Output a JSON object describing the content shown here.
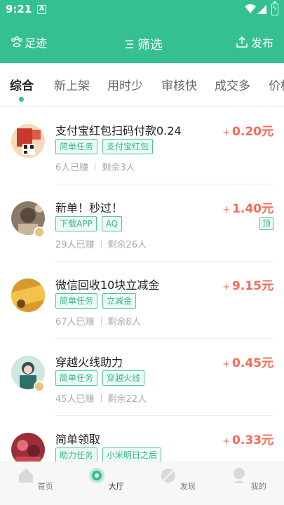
{
  "status": {
    "time": "9:21",
    "sim_label": "A"
  },
  "header": {
    "left_label": "足迹",
    "center_label": "筛选",
    "right_label": "发布"
  },
  "tabs": [
    "综合",
    "新上架",
    "用时少",
    "审核快",
    "成交多",
    "价格"
  ],
  "tasks": [
    {
      "title": "支付宝红包扫码付款0.24",
      "tags": [
        "简单任务",
        "支付宝红包"
      ],
      "earned": "6人已赚",
      "remaining": "剩余3人",
      "plus": "+",
      "price": "0.20元",
      "top_badge": ""
    },
    {
      "title": "新单！秒过！",
      "tags": [
        "下载APP",
        "AQ"
      ],
      "earned": "29人已赚",
      "remaining": "剩余26人",
      "plus": "+",
      "price": "1.40元",
      "top_badge": "顶"
    },
    {
      "title": "微信回收10块立减金",
      "tags": [
        "简单任务",
        "立减金"
      ],
      "earned": "67人已赚",
      "remaining": "剩余8人",
      "plus": "+",
      "price": "9.15元",
      "top_badge": ""
    },
    {
      "title": "穿越火线助力",
      "tags": [
        "简单任务",
        "穿越火线"
      ],
      "earned": "45人已赚",
      "remaining": "剩余22人",
      "plus": "+",
      "price": "0.45元",
      "top_badge": ""
    },
    {
      "title": "简单领取",
      "tags": [
        "助力任务",
        "小米明日之后"
      ],
      "earned": "",
      "remaining": "",
      "plus": "+",
      "price": "0.33元",
      "top_badge": ""
    }
  ],
  "bottom_nav": [
    {
      "label": "首页",
      "icon": "home-icon"
    },
    {
      "label": "大厅",
      "icon": "hall-icon"
    },
    {
      "label": "发现",
      "icon": "discover-icon"
    },
    {
      "label": "我的",
      "icon": "profile-icon"
    }
  ],
  "colors": {
    "brand": "#35c08f",
    "price": "#f56a57",
    "tag_border": "#4cc79b"
  }
}
